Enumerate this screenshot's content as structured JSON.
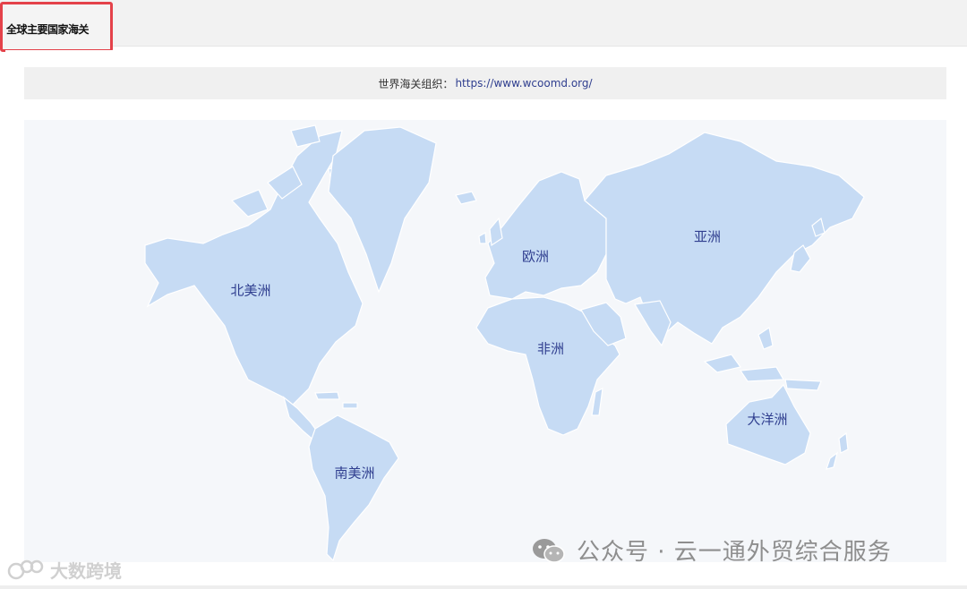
{
  "tab": {
    "label": "全球主要国家海关"
  },
  "info": {
    "prefix": "世界海关组织：",
    "url": "https://www.wcoomd.org/"
  },
  "map": {
    "land_color": "#c6dbf4",
    "label_color": "#2f3e8f",
    "continents": [
      {
        "id": "north-america",
        "label": "北美洲"
      },
      {
        "id": "south-america",
        "label": "南美洲"
      },
      {
        "id": "europe",
        "label": "欧洲"
      },
      {
        "id": "africa",
        "label": "非洲"
      },
      {
        "id": "asia",
        "label": "亚洲"
      },
      {
        "id": "oceania",
        "label": "大洋洲"
      }
    ]
  },
  "watermarks": {
    "right": "公众号 · 云一通外贸综合服务",
    "left": "大数跨境"
  }
}
